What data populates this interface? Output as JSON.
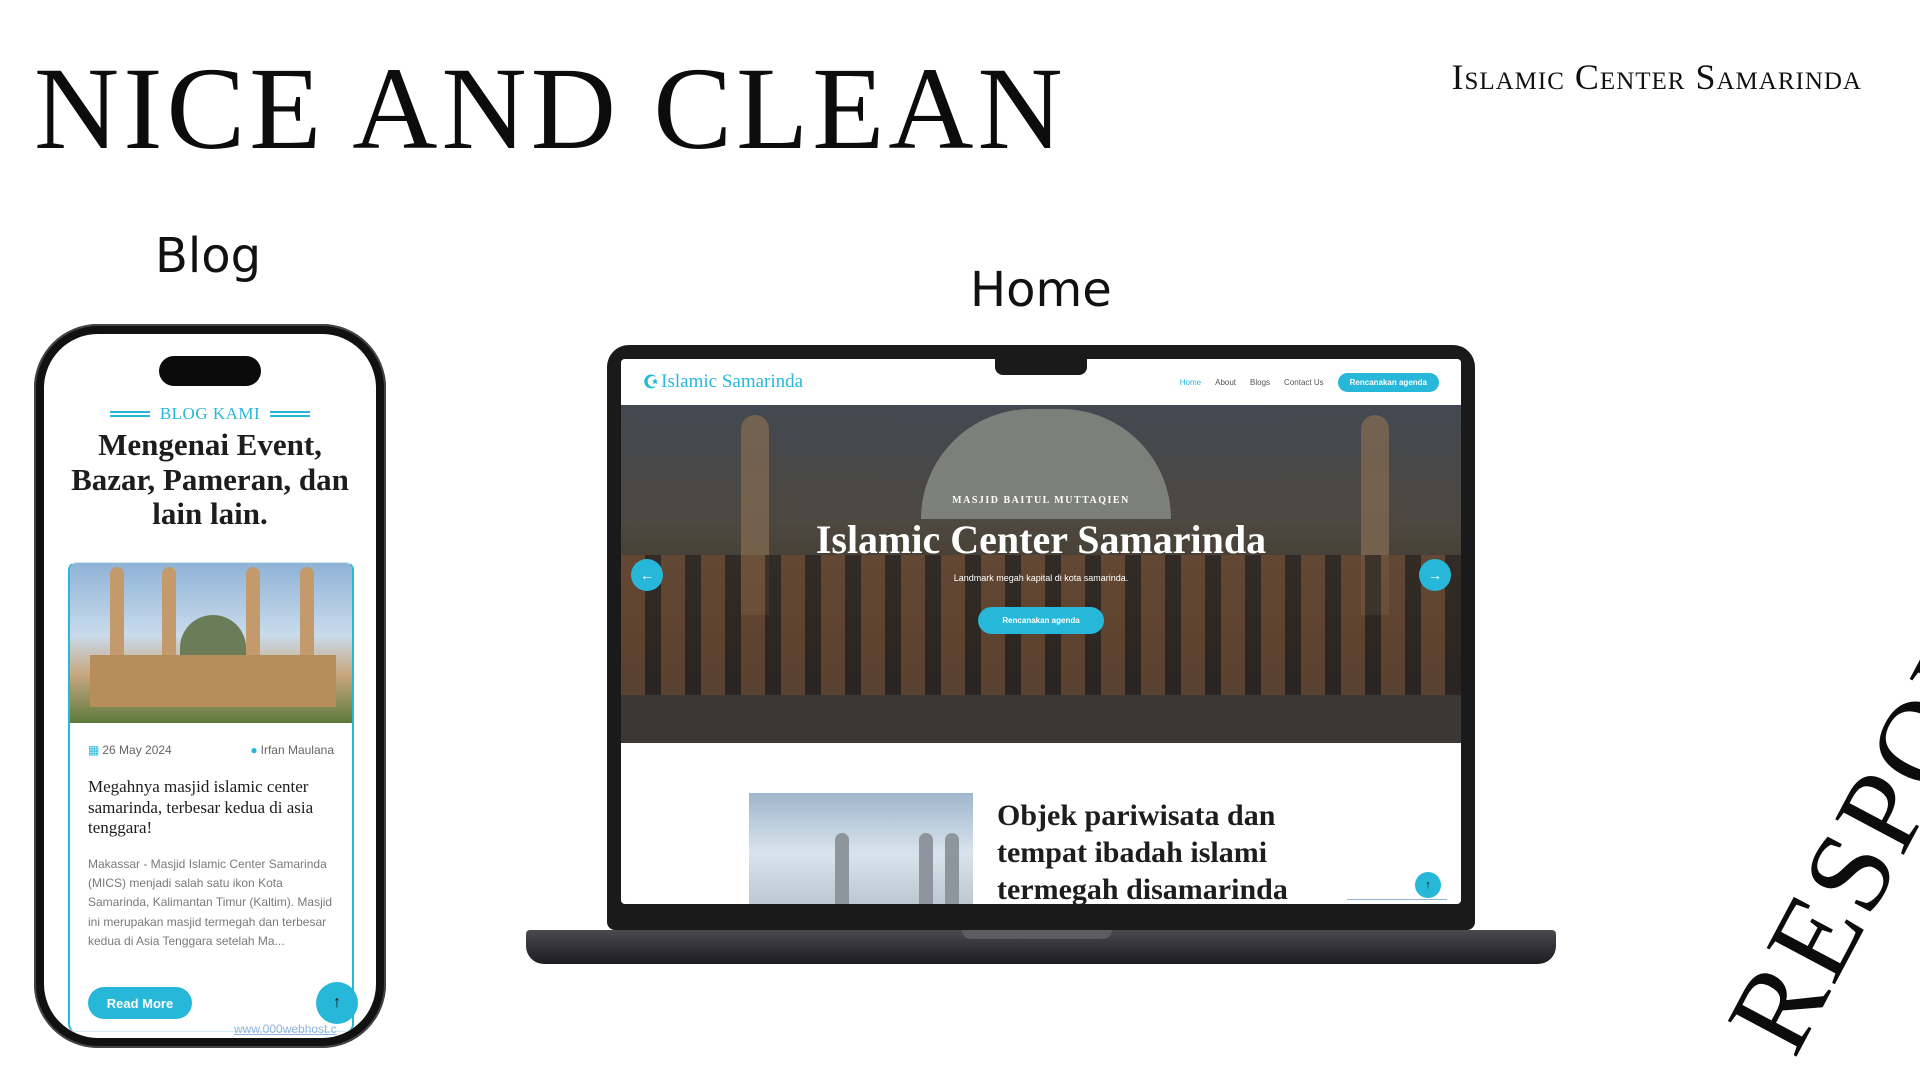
{
  "headline": "NICE AND CLEAN",
  "brand": "Islamic Center Samarinda",
  "captions": {
    "blog": "Blog",
    "home": "Home"
  },
  "side_text": "RESPONSIVE",
  "phone": {
    "kicker": "BLOG KAMI",
    "title": "Mengenai Event, Bazar, Pameran, dan lain lain.",
    "post": {
      "date": "26 May 2024",
      "author": "Irfan Maulana",
      "title": "Megahnya masjid islamic center samarinda, terbesar kedua di asia tenggara!",
      "excerpt": "Makassar - Masjid Islamic Center Samarinda (MICS) menjadi salah satu ikon Kota Samarinda, Kalimantan Timur (Kaltim). Masjid ini merupakan masjid termegah dan terbesar kedua di Asia Tenggara setelah Ma...",
      "button": "Read More"
    },
    "watermark": "www.000webhost.c",
    "scroll_top_icon": "arrow-up-icon"
  },
  "laptop": {
    "logo_text": "Islamic Samarinda",
    "nav": [
      "Home",
      "About",
      "Blogs",
      "Contact Us"
    ],
    "nav_active": "Home",
    "nav_button": "Rencanakan agenda",
    "hero": {
      "kicker": "MASJID BAITUL MUTTAQIEN",
      "title": "Islamic Center Samarinda",
      "subtitle": "Landmark megah kapital di kota samarinda.",
      "button": "Rencanakan agenda"
    },
    "section_title": "Objek pariwisata dan tempat ibadah islami termegah disamarinda",
    "accent": "#27b7d8"
  }
}
